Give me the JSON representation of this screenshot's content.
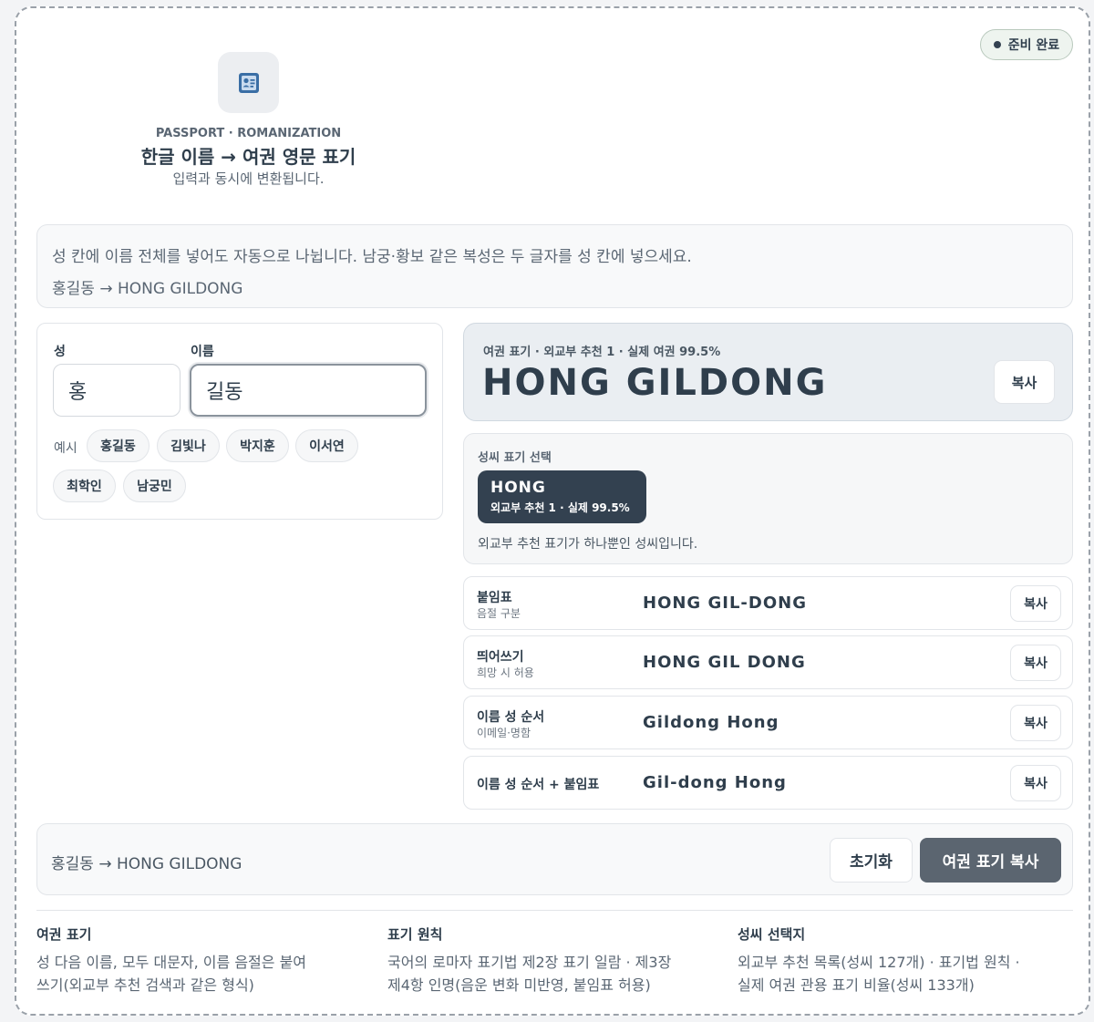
{
  "status": {
    "label": "준비 완료"
  },
  "header": {
    "kicker": "PASSPORT · ROMANIZATION",
    "title": "한글 이름 → 여권 영문 표기",
    "subtitle": "입력과 동시에 변환됩니다."
  },
  "notice": {
    "line1": "성 칸에 이름 전체를 넣어도 자동으로 나뉩니다. 남궁·황보 같은 복성은 두 글자를 성 칸에 넣으세요.",
    "line2": "홍길동 → HONG GILDONG"
  },
  "form": {
    "surname_label": "성",
    "surname_value": "홍",
    "given_label": "이름",
    "given_value": "길동",
    "examples_label": "예시",
    "examples": [
      "홍길동",
      "김빛나",
      "박지훈",
      "이서연",
      "최학인",
      "남궁민"
    ]
  },
  "result": {
    "caption": "여권 표기 · 외교부 추천 1 · 실제 여권 99.5%",
    "value": "HONG GILDONG",
    "copy_label": "복사"
  },
  "surname_select": {
    "caption": "성씨 표기 선택",
    "option_name": "HONG",
    "option_sub": "외교부 추천 1 · 실제 99.5%",
    "note": "외교부 추천 표기가 하나뿐인 성씨입니다."
  },
  "variants": [
    {
      "label": "붙임표",
      "sub": "음절 구분",
      "value": "HONG GIL-DONG",
      "copy": "복사"
    },
    {
      "label": "띄어쓰기",
      "sub": "희망 시 허용",
      "value": "HONG GIL DONG",
      "copy": "복사"
    },
    {
      "label": "이름 성 순서",
      "sub": "이메일·명함",
      "value": "Gildong Hong",
      "copy": "복사"
    },
    {
      "label": "이름 성 순서 + 붙임표",
      "sub": "",
      "value": "Gil-dong Hong",
      "copy": "복사"
    }
  ],
  "bottom": {
    "summary": "홍길동 → HONG GILDONG",
    "reset_label": "초기화",
    "copy_label": "여권 표기 복사"
  },
  "footer": [
    {
      "title": "여권 표기",
      "line1": "성 다음 이름, 모두 대문자, 이름 음절은 붙여",
      "line2": "쓰기(외교부 추천 검색과 같은 형식)"
    },
    {
      "title": "표기 원칙",
      "line1": "국어의 로마자 표기법 제2장 표기 일람 · 제3장",
      "line2": "제4항 인명(음운 변화 미반영, 붙임표 허용)"
    },
    {
      "title": "성씨 선택지",
      "line1": "외교부 추천 목록(성씨 127개) · 표기법 원칙 ·",
      "line2": "실제 여권 관용 표기 비율(성씨 133개)"
    }
  ]
}
